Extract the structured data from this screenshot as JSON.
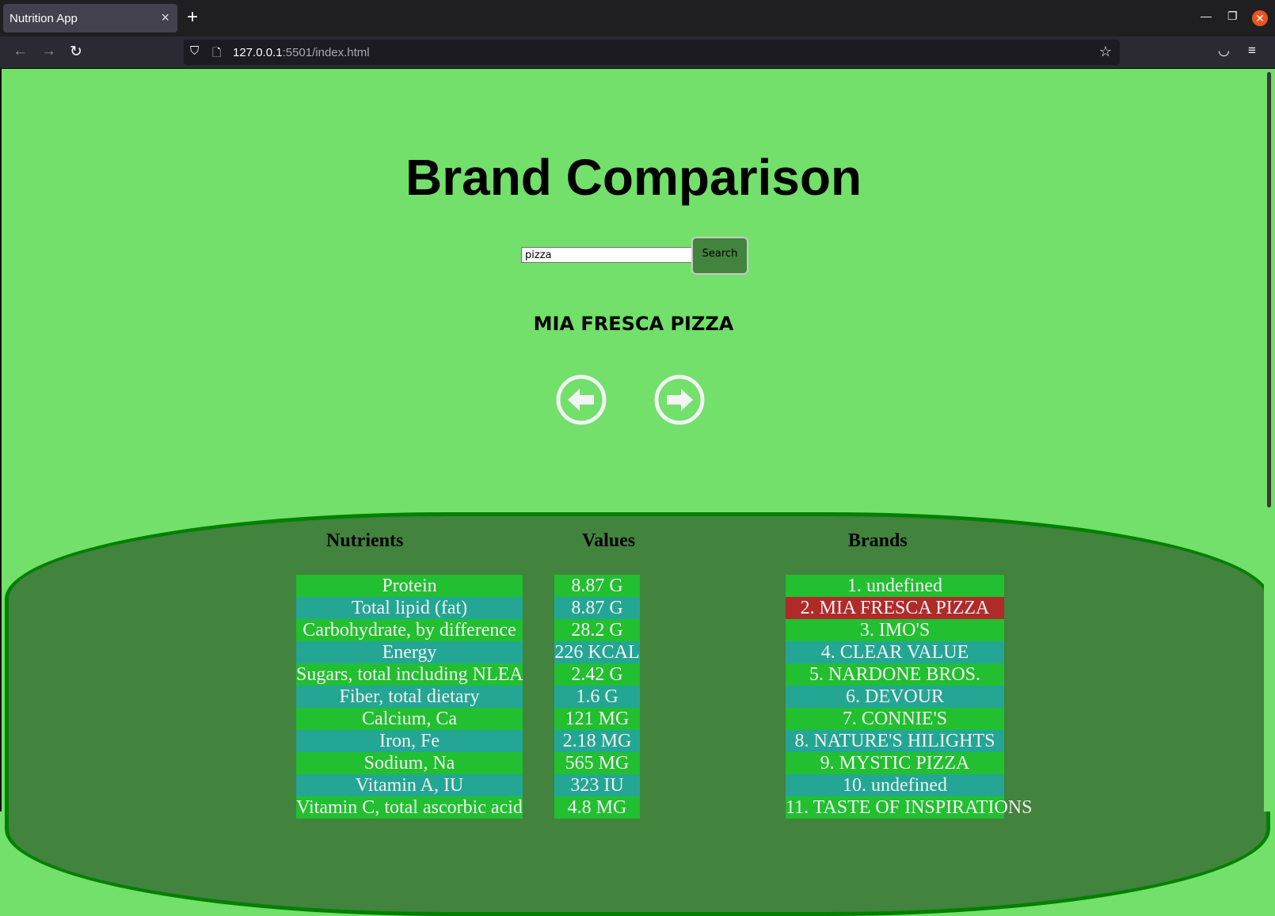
{
  "browser": {
    "tab_title": "Nutrition App",
    "url_host": "127.0.0.1",
    "url_rest": ":5501/index.html"
  },
  "page": {
    "heading": "Brand Comparison",
    "search": {
      "value": "pizza",
      "button_label": "Search"
    },
    "product_name": "MIA FRESCA PIZZA",
    "columns": {
      "nutrients": "Nutrients",
      "values": "Values",
      "brands": "Brands"
    },
    "nutrients": [
      "Protein",
      "Total lipid (fat)",
      "Carbohydrate, by difference",
      "Energy",
      "Sugars, total including NLEA",
      "Fiber, total dietary",
      "Calcium, Ca",
      "Iron, Fe",
      "Sodium, Na",
      "Vitamin A, IU",
      "Vitamin C, total ascorbic acid"
    ],
    "values": [
      "8.87 G",
      "8.87 G",
      "28.2 G",
      "226 KCAL",
      "2.42 G",
      "1.6 G",
      "121 MG",
      "2.18 MG",
      "565 MG",
      "323 IU",
      "4.8 MG"
    ],
    "brands": [
      "1. undefined",
      "2. MIA FRESCA PIZZA",
      "3. IMO'S",
      "4. CLEAR VALUE",
      "5. NARDONE BROS.",
      "6. DEVOUR",
      "7. CONNIE'S",
      "8. NATURE'S HILIGHTS",
      "9. MYSTIC PIZZA",
      "10. undefined",
      "11. TASTE OF INSPIRATIONS"
    ],
    "selected_brand_index": 1,
    "colors": {
      "background": "#72e06a",
      "panel": "#42833d",
      "row_green": "#22bf31",
      "row_teal": "#24a694",
      "selected": "#b02a2a"
    }
  }
}
